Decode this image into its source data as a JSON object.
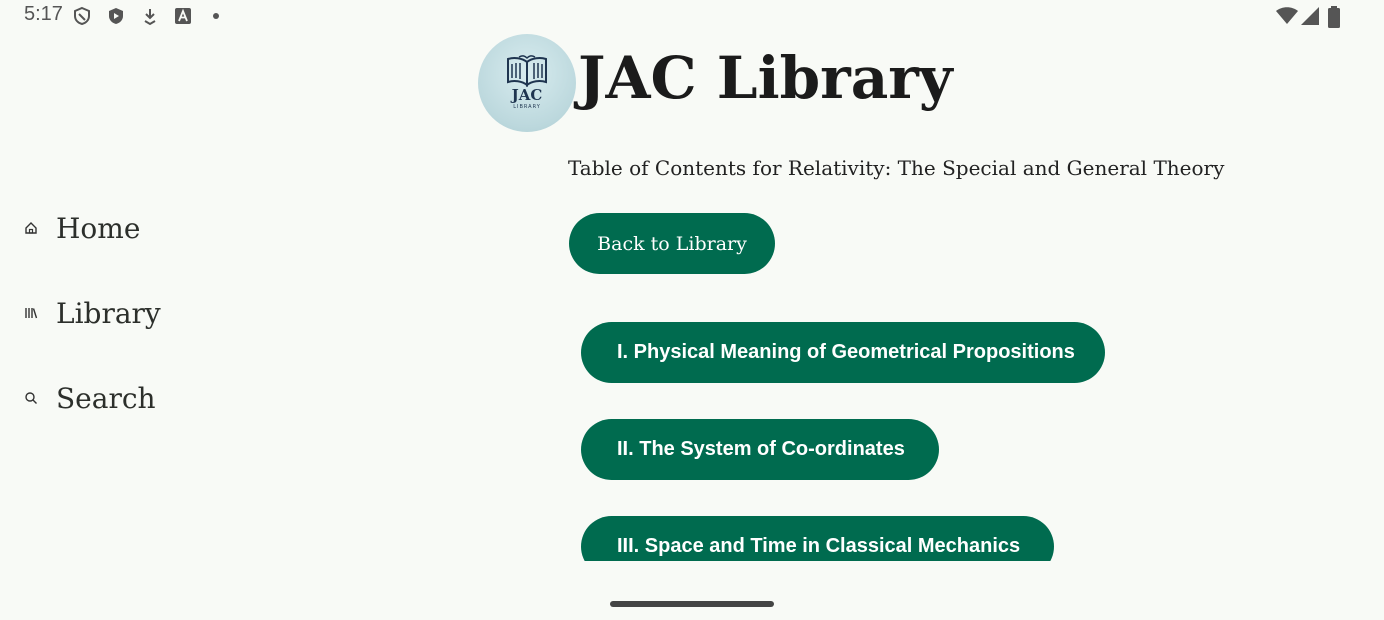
{
  "status_bar": {
    "time": "5:17",
    "left_icons": [
      "shield-outline-icon",
      "play-protect-icon",
      "download-icon",
      "font-icon",
      "dot-icon"
    ],
    "right_icons": [
      "wifi-icon",
      "cellular-icon",
      "battery-icon"
    ]
  },
  "header": {
    "logo_text": "JAC",
    "logo_subtext": "LIBRARY",
    "app_title": "JAC Library",
    "subtitle": "Table of Contents for  Relativity: The Special and General Theory"
  },
  "sidebar": {
    "items": [
      {
        "label": "Home",
        "icon": "home-icon"
      },
      {
        "label": "Library",
        "icon": "library-icon"
      },
      {
        "label": "Search",
        "icon": "search-icon"
      }
    ]
  },
  "main": {
    "back_button_label": "Back to Library",
    "chapters": [
      "I. Physical Meaning of Geometrical Propositions",
      "II. The System of Co-ordinates",
      "III. Space and Time in Classical Mechanics"
    ]
  },
  "colors": {
    "background": "#f8faf6",
    "accent": "#006b4f"
  }
}
